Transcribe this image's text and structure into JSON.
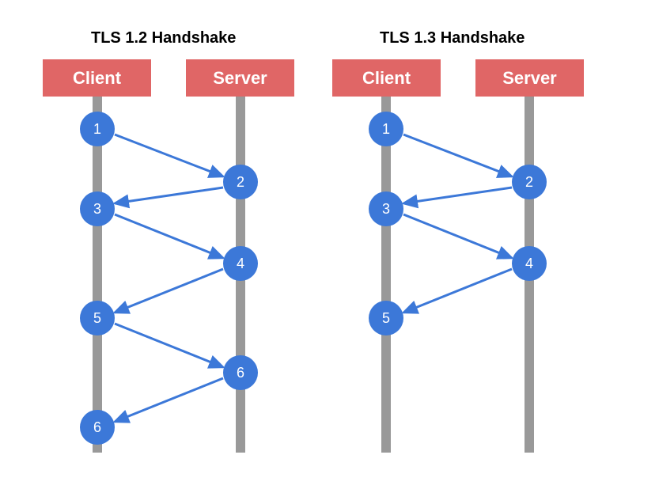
{
  "colors": {
    "box": "#e06666",
    "circle": "#3c78d8",
    "arrow": "#3c78d8",
    "lifeline": "#999999"
  },
  "diagrams": [
    {
      "title": "TLS 1.2 Handshake",
      "client_label": "Client",
      "server_label": "Server",
      "steps": [
        "1",
        "2",
        "3",
        "4",
        "5",
        "6",
        "6"
      ]
    },
    {
      "title": "TLS 1.3 Handshake",
      "client_label": "Client",
      "server_label": "Server",
      "steps": [
        "1",
        "2",
        "3",
        "4",
        "5"
      ]
    }
  ],
  "chart_data": [
    {
      "type": "sequence",
      "title": "TLS 1.2 Handshake",
      "participants": [
        "Client",
        "Server"
      ],
      "messages": [
        {
          "step": 1,
          "at": "Client"
        },
        {
          "step": 2,
          "at": "Server"
        },
        {
          "step": 3,
          "at": "Client"
        },
        {
          "step": 4,
          "at": "Server"
        },
        {
          "step": 5,
          "at": "Client"
        },
        {
          "step": 6,
          "at": "Server"
        },
        {
          "step": 6,
          "at": "Client"
        }
      ],
      "arrows": [
        {
          "from": 1,
          "to": 2
        },
        {
          "from": 2,
          "to": 3
        },
        {
          "from": 3,
          "to": 4
        },
        {
          "from": 4,
          "to": 5
        },
        {
          "from": 5,
          "to": 6
        },
        {
          "from": 6,
          "to": 7
        }
      ]
    },
    {
      "type": "sequence",
      "title": "TLS 1.3 Handshake",
      "participants": [
        "Client",
        "Server"
      ],
      "messages": [
        {
          "step": 1,
          "at": "Client"
        },
        {
          "step": 2,
          "at": "Server"
        },
        {
          "step": 3,
          "at": "Client"
        },
        {
          "step": 4,
          "at": "Server"
        },
        {
          "step": 5,
          "at": "Client"
        }
      ],
      "arrows": [
        {
          "from": 1,
          "to": 2
        },
        {
          "from": 2,
          "to": 3
        },
        {
          "from": 3,
          "to": 4
        },
        {
          "from": 4,
          "to": 5
        }
      ]
    }
  ]
}
